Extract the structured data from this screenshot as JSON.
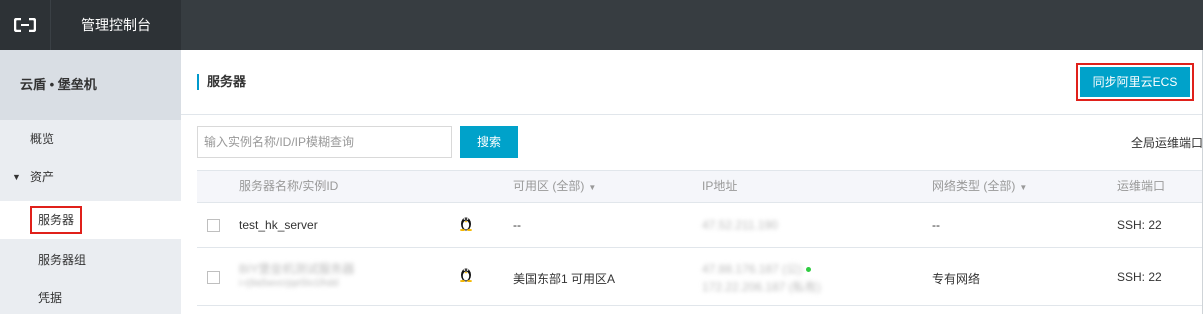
{
  "header": {
    "logo_icon": "aliyun-logo-icon",
    "console_title": "管理控制台"
  },
  "sidebar": {
    "product_title": "云盾 • 堡垒机",
    "items": [
      {
        "label": "概览",
        "icon": null
      },
      {
        "label": "资产",
        "icon": "caret-down-icon"
      },
      {
        "label": "服务器",
        "active": true
      },
      {
        "label": "服务器组"
      },
      {
        "label": "凭据"
      }
    ]
  },
  "main": {
    "page_title": "服务器",
    "sync_button": "同步阿里云ECS",
    "search": {
      "placeholder": "输入实例名称/ID/IP模糊查询",
      "value": "",
      "button": "搜索"
    },
    "global_port_label": "全局运维端口",
    "table": {
      "headers": {
        "name": "服务器名称/实例ID",
        "zone": "可用区 (全部)",
        "ip": "IP地址",
        "network": "网络类型 (全部)",
        "port": "运维端口"
      },
      "rows": [
        {
          "name": "test_hk_server",
          "instance_id": "",
          "os_icon": "linux-penguin-icon",
          "zone": "--",
          "ip_primary": "47.52.211.190",
          "ip_secondary": "",
          "network": "--",
          "port": "SSH: 22"
        },
        {
          "name": "BIY堡垒机测试服务器",
          "instance_id": "i-rj9a5wvcrjqe5lo1lhdd",
          "os_icon": "linux-penguin-icon",
          "zone": "美国东部1 可用区A",
          "ip_primary": "47.88.176.187 (公)",
          "ip_secondary": "172.22.206.187 (私有)",
          "network": "专有网络",
          "port": "SSH: 22"
        }
      ]
    }
  },
  "colors": {
    "topbar": "#373d41",
    "accent": "#00a2ca",
    "highlight": "#e0201a",
    "sidebar_bg": "#eaedf1"
  }
}
